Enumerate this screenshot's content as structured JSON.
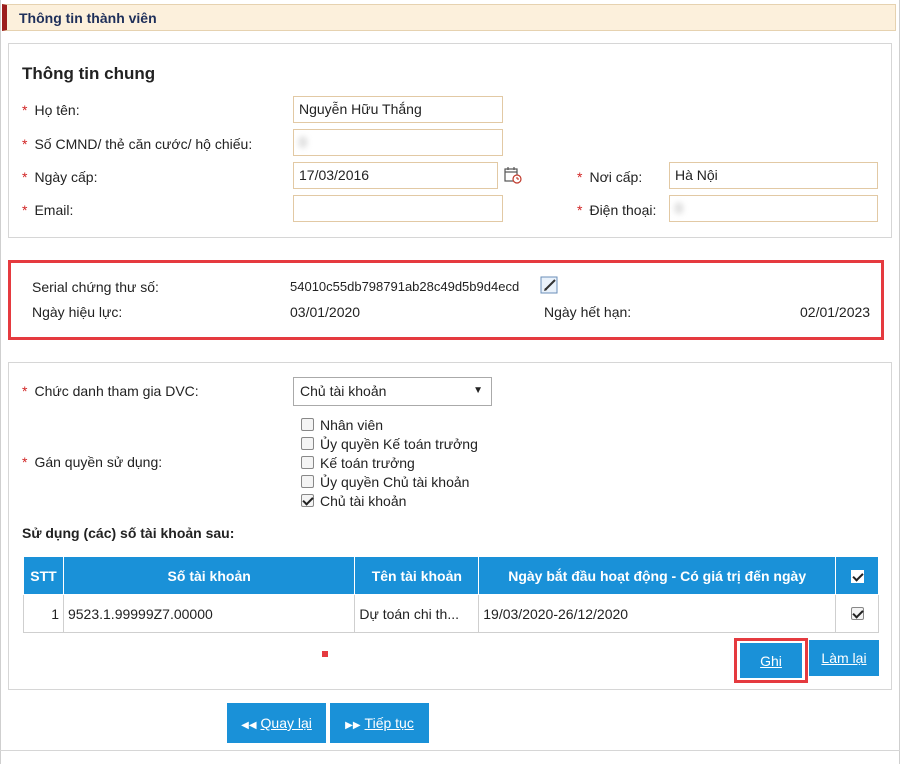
{
  "header": {
    "title": "Thông tin thành viên"
  },
  "general": {
    "title": "Thông tin chung",
    "ho_ten": {
      "label": "Họ tên:",
      "value": "Nguyễn Hữu Thắng"
    },
    "cmnd": {
      "label": "Số CMND/ thẻ căn cước/ hộ chiếu:",
      "value": "0"
    },
    "ngay_cap": {
      "label": "Ngày cấp:",
      "value": "17/03/2016"
    },
    "noi_cap": {
      "label": "Nơi cấp:",
      "value": "Hà Nội"
    },
    "email": {
      "label": "Email:",
      "value": ""
    },
    "dien_thoai": {
      "label": "Điện thoại:",
      "value": "0"
    }
  },
  "certificate": {
    "serial_label": "Serial chứng thư số:",
    "serial_value": "54010c55db798791ab28c49d5b9d4ecd",
    "effective_label": "Ngày hiệu lực:",
    "effective_value": "03/01/2020",
    "expiry_label": "Ngày hết hạn:",
    "expiry_value": "02/01/2023"
  },
  "role": {
    "position_label": "Chức danh tham gia DVC:",
    "position_value": "Chủ tài khoản",
    "rights_label": "Gán quyền sử dụng:",
    "options": [
      {
        "label": "Nhân viên",
        "checked": false
      },
      {
        "label": "Ủy quyền Kế toán trưởng",
        "checked": false
      },
      {
        "label": "Kế toán trưởng",
        "checked": false
      },
      {
        "label": "Ủy quyền Chủ tài khoản",
        "checked": false
      },
      {
        "label": "Chủ tài khoản",
        "checked": true
      }
    ]
  },
  "accounts": {
    "title": "Sử dụng (các) số tài khoản sau:",
    "columns": [
      "STT",
      "Số tài khoản",
      "Tên tài khoản",
      "Ngày bắt đầu hoạt động - Có giá trị đến ngày"
    ],
    "rows": [
      {
        "stt": "1",
        "so_tk": "9523.1.99999Z7.00000",
        "ten_tk": "Dự toán chi th...",
        "dates": "19/03/2020-26/12/2020",
        "checked": true
      }
    ]
  },
  "buttons": {
    "save": "Ghi",
    "reset": "Làm lại",
    "back": "Quay lại",
    "next": "Tiếp tục"
  },
  "colors": {
    "accent": "#1a91d8",
    "highlight": "#e53a3f",
    "header_bg": "#fcf0dc",
    "header_stripe": "#9c1d1d",
    "required": "#d12424"
  }
}
